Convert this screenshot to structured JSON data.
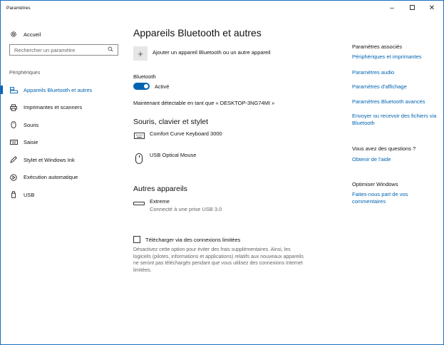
{
  "window": {
    "title": "Paramètres",
    "minimize_glyph": "–",
    "close_glyph": "✕"
  },
  "sidebar": {
    "home_label": "Accueil",
    "search_placeholder": "Rechercher un paramètre",
    "section_label": "Périphériques",
    "items": [
      {
        "label": "Appareils Bluetooth et autres",
        "icon": "bluetooth-devices-icon",
        "active": true
      },
      {
        "label": "Imprimantes et scanners",
        "icon": "printer-icon"
      },
      {
        "label": "Souris",
        "icon": "mouse-icon"
      },
      {
        "label": "Saisie",
        "icon": "keyboard-icon"
      },
      {
        "label": "Stylet et Windows Ink",
        "icon": "pen-icon"
      },
      {
        "label": "Exécution automatique",
        "icon": "autoplay-icon"
      },
      {
        "label": "USB",
        "icon": "usb-icon"
      }
    ]
  },
  "main": {
    "title": "Appareils Bluetooth et autres",
    "add_device_label": "Ajouter un appareil Bluetooth ou un autre appareil",
    "bluetooth_label": "Bluetooth",
    "bluetooth_state": "Activé",
    "discoverable_text": "Maintenant détectable en tant que « DESKTOP-3NG74MI »",
    "devices_heading": "Souris, clavier et stylet",
    "devices": [
      {
        "name": "Comfort Curve Keyboard 3000",
        "icon": "keyboard-icon"
      },
      {
        "name": "USB Optical Mouse",
        "icon": "mouse-icon"
      }
    ],
    "other_heading": "Autres appareils",
    "other_devices": [
      {
        "name": "Extreme",
        "status": "Connecté à une prise USB 3.0",
        "icon": "usb-device-icon"
      }
    ],
    "metered_label": "Télécharger via des connexions limitées",
    "metered_description": "Désactivez cette option pour éviter des frais supplémentaires. Ainsi, les logiciels (pilotes, informations et applications) relatifs aux nouveaux appareils ne seront pas téléchargés pendant que vous utilisez des connexions Internet limitées."
  },
  "related": {
    "heading": "Paramètres associés",
    "links": [
      "Périphériques et imprimantes",
      "Paramètres audio",
      "Paramètres d'affichage",
      "Paramètres Bluetooth avancés",
      "Envoyer ou recevoir des fichiers via Bluetooth"
    ],
    "questions_heading": "Vous avez des questions ?",
    "help_link": "Obtenir de l'aide",
    "improve_heading": "Optimiser Windows",
    "feedback_link": "Faites-nous part de vos commentaires"
  },
  "colors": {
    "accent": "#0063b1",
    "window_border": "#1e6fbf"
  }
}
